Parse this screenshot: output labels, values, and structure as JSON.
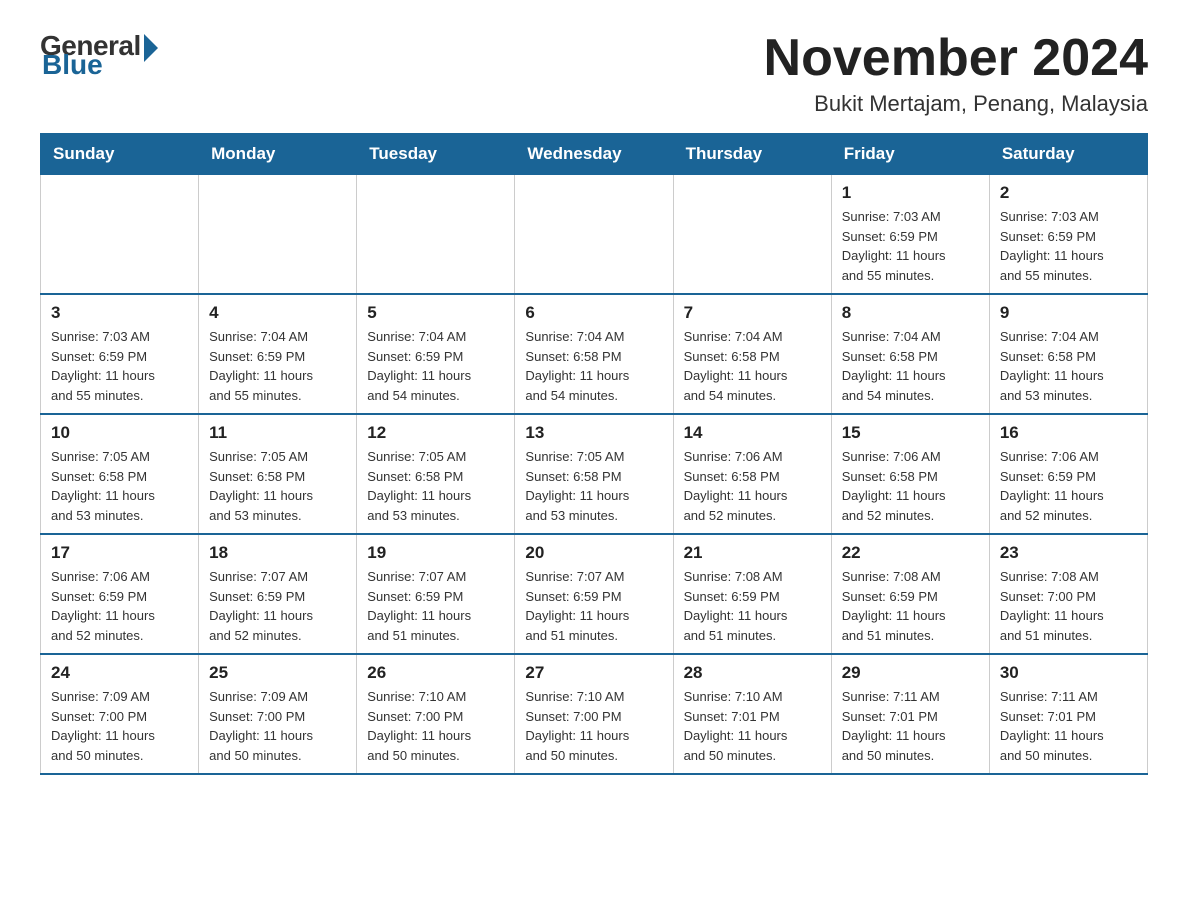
{
  "logo": {
    "general": "General",
    "blue": "Blue"
  },
  "title": "November 2024",
  "subtitle": "Bukit Mertajam, Penang, Malaysia",
  "weekdays": [
    "Sunday",
    "Monday",
    "Tuesday",
    "Wednesday",
    "Thursday",
    "Friday",
    "Saturday"
  ],
  "weeks": [
    [
      {
        "day": "",
        "info": ""
      },
      {
        "day": "",
        "info": ""
      },
      {
        "day": "",
        "info": ""
      },
      {
        "day": "",
        "info": ""
      },
      {
        "day": "",
        "info": ""
      },
      {
        "day": "1",
        "info": "Sunrise: 7:03 AM\nSunset: 6:59 PM\nDaylight: 11 hours\nand 55 minutes."
      },
      {
        "day": "2",
        "info": "Sunrise: 7:03 AM\nSunset: 6:59 PM\nDaylight: 11 hours\nand 55 minutes."
      }
    ],
    [
      {
        "day": "3",
        "info": "Sunrise: 7:03 AM\nSunset: 6:59 PM\nDaylight: 11 hours\nand 55 minutes."
      },
      {
        "day": "4",
        "info": "Sunrise: 7:04 AM\nSunset: 6:59 PM\nDaylight: 11 hours\nand 55 minutes."
      },
      {
        "day": "5",
        "info": "Sunrise: 7:04 AM\nSunset: 6:59 PM\nDaylight: 11 hours\nand 54 minutes."
      },
      {
        "day": "6",
        "info": "Sunrise: 7:04 AM\nSunset: 6:58 PM\nDaylight: 11 hours\nand 54 minutes."
      },
      {
        "day": "7",
        "info": "Sunrise: 7:04 AM\nSunset: 6:58 PM\nDaylight: 11 hours\nand 54 minutes."
      },
      {
        "day": "8",
        "info": "Sunrise: 7:04 AM\nSunset: 6:58 PM\nDaylight: 11 hours\nand 54 minutes."
      },
      {
        "day": "9",
        "info": "Sunrise: 7:04 AM\nSunset: 6:58 PM\nDaylight: 11 hours\nand 53 minutes."
      }
    ],
    [
      {
        "day": "10",
        "info": "Sunrise: 7:05 AM\nSunset: 6:58 PM\nDaylight: 11 hours\nand 53 minutes."
      },
      {
        "day": "11",
        "info": "Sunrise: 7:05 AM\nSunset: 6:58 PM\nDaylight: 11 hours\nand 53 minutes."
      },
      {
        "day": "12",
        "info": "Sunrise: 7:05 AM\nSunset: 6:58 PM\nDaylight: 11 hours\nand 53 minutes."
      },
      {
        "day": "13",
        "info": "Sunrise: 7:05 AM\nSunset: 6:58 PM\nDaylight: 11 hours\nand 53 minutes."
      },
      {
        "day": "14",
        "info": "Sunrise: 7:06 AM\nSunset: 6:58 PM\nDaylight: 11 hours\nand 52 minutes."
      },
      {
        "day": "15",
        "info": "Sunrise: 7:06 AM\nSunset: 6:58 PM\nDaylight: 11 hours\nand 52 minutes."
      },
      {
        "day": "16",
        "info": "Sunrise: 7:06 AM\nSunset: 6:59 PM\nDaylight: 11 hours\nand 52 minutes."
      }
    ],
    [
      {
        "day": "17",
        "info": "Sunrise: 7:06 AM\nSunset: 6:59 PM\nDaylight: 11 hours\nand 52 minutes."
      },
      {
        "day": "18",
        "info": "Sunrise: 7:07 AM\nSunset: 6:59 PM\nDaylight: 11 hours\nand 52 minutes."
      },
      {
        "day": "19",
        "info": "Sunrise: 7:07 AM\nSunset: 6:59 PM\nDaylight: 11 hours\nand 51 minutes."
      },
      {
        "day": "20",
        "info": "Sunrise: 7:07 AM\nSunset: 6:59 PM\nDaylight: 11 hours\nand 51 minutes."
      },
      {
        "day": "21",
        "info": "Sunrise: 7:08 AM\nSunset: 6:59 PM\nDaylight: 11 hours\nand 51 minutes."
      },
      {
        "day": "22",
        "info": "Sunrise: 7:08 AM\nSunset: 6:59 PM\nDaylight: 11 hours\nand 51 minutes."
      },
      {
        "day": "23",
        "info": "Sunrise: 7:08 AM\nSunset: 7:00 PM\nDaylight: 11 hours\nand 51 minutes."
      }
    ],
    [
      {
        "day": "24",
        "info": "Sunrise: 7:09 AM\nSunset: 7:00 PM\nDaylight: 11 hours\nand 50 minutes."
      },
      {
        "day": "25",
        "info": "Sunrise: 7:09 AM\nSunset: 7:00 PM\nDaylight: 11 hours\nand 50 minutes."
      },
      {
        "day": "26",
        "info": "Sunrise: 7:10 AM\nSunset: 7:00 PM\nDaylight: 11 hours\nand 50 minutes."
      },
      {
        "day": "27",
        "info": "Sunrise: 7:10 AM\nSunset: 7:00 PM\nDaylight: 11 hours\nand 50 minutes."
      },
      {
        "day": "28",
        "info": "Sunrise: 7:10 AM\nSunset: 7:01 PM\nDaylight: 11 hours\nand 50 minutes."
      },
      {
        "day": "29",
        "info": "Sunrise: 7:11 AM\nSunset: 7:01 PM\nDaylight: 11 hours\nand 50 minutes."
      },
      {
        "day": "30",
        "info": "Sunrise: 7:11 AM\nSunset: 7:01 PM\nDaylight: 11 hours\nand 50 minutes."
      }
    ]
  ]
}
